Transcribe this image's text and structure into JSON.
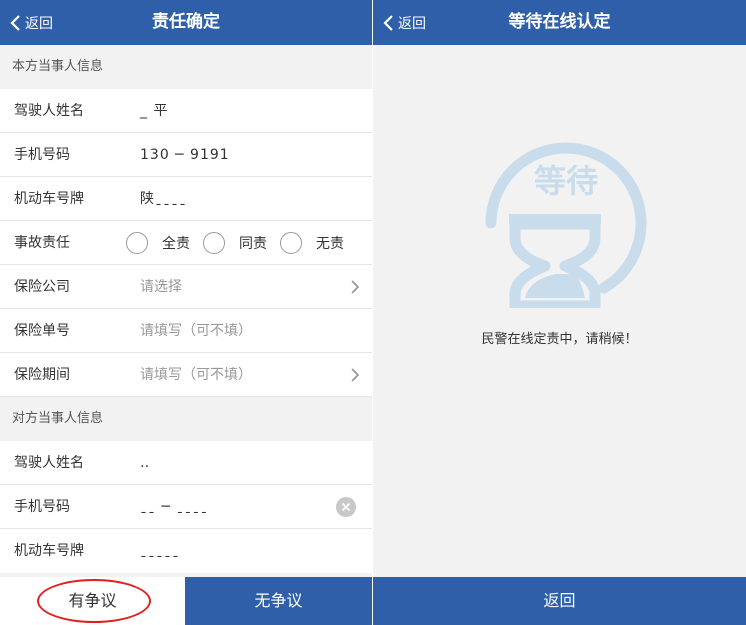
{
  "left": {
    "nav": {
      "back_label": "返回",
      "title": "责任确定"
    },
    "own_section": {
      "header": "本方当事人信息",
      "driver_label": "驾驶人姓名",
      "driver_value": "_ 平",
      "phone_label": "手机号码",
      "phone_value": "130 ─ 9191",
      "plate_label": "机动车号牌",
      "plate_value": "陕ˍˍˍˍ",
      "liability_label": "事故责任",
      "liability_options": [
        "全责",
        "同责",
        "无责"
      ],
      "insurer_label": "保险公司",
      "insurer_placeholder": "请选择",
      "policy_label": "保险单号",
      "policy_placeholder": "请填写（可不填）",
      "period_label": "保险期间",
      "period_placeholder": "请填写（可不填）"
    },
    "other_section": {
      "header": "对方当事人信息",
      "driver_label": "驾驶人姓名",
      "driver_value": "‥",
      "phone_label": "手机号码",
      "phone_value": "ˍˍ ─ ˍˍˍˍ",
      "plate_label": "机动车号牌",
      "plate_value": "ˍˍˍˍˍ"
    },
    "actions": {
      "dispute_label": "有争议",
      "no_dispute_label": "无争议"
    }
  },
  "right": {
    "nav": {
      "back_label": "返回",
      "title": "等待在线认定"
    },
    "illustration_text": "等待",
    "message": "民警在线定责中，请稍候！",
    "return_label": "返回"
  },
  "colors": {
    "primary": "#2f5fa8",
    "illustration": "#c9dcec",
    "annotation": "#e02020"
  },
  "icons": [
    "chevron-left-icon",
    "chevron-right-icon",
    "clear-icon",
    "hourglass-icon"
  ]
}
